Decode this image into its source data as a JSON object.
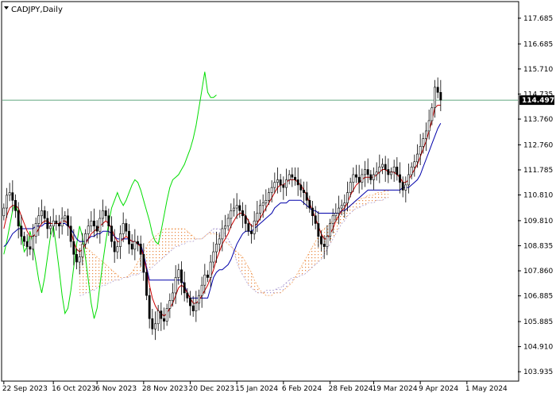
{
  "chart_data": {
    "type": "candlestick",
    "title": "CADJPY,Daily",
    "current_price": "114.497",
    "current_price_value": 114.497,
    "ylim": [
      103.6,
      118.3
    ],
    "y_ticks": [
      {
        "label": "117.685",
        "value": 117.685
      },
      {
        "label": "116.685",
        "value": 116.685
      },
      {
        "label": "115.710",
        "value": 115.71
      },
      {
        "label": "114.735",
        "value": 114.735
      },
      {
        "label": "113.760",
        "value": 113.76
      },
      {
        "label": "112.760",
        "value": 112.76
      },
      {
        "label": "111.785",
        "value": 111.785
      },
      {
        "label": "110.810",
        "value": 110.81
      },
      {
        "label": "109.810",
        "value": 109.81
      },
      {
        "label": "108.835",
        "value": 108.835
      },
      {
        "label": "107.860",
        "value": 107.86
      },
      {
        "label": "106.885",
        "value": 106.885
      },
      {
        "label": "105.885",
        "value": 105.885
      },
      {
        "label": "104.910",
        "value": 104.91
      },
      {
        "label": "103.935",
        "value": 103.935
      }
    ],
    "x_ticks": [
      {
        "label": "22 Sep 2023",
        "index": 0
      },
      {
        "label": "16 Oct 2023",
        "index": 17
      },
      {
        "label": "6 Nov 2023",
        "index": 32
      },
      {
        "label": "28 Nov 2023",
        "index": 48
      },
      {
        "label": "20 Dec 2023",
        "index": 64
      },
      {
        "label": "15 Jan 2024",
        "index": 80
      },
      {
        "label": "6 Feb 2024",
        "index": 96
      },
      {
        "label": "28 Feb 2024",
        "index": 112
      },
      {
        "label": "19 Mar 2024",
        "index": 127
      },
      {
        "label": "9 Apr 2024",
        "index": 143
      },
      {
        "label": "1 May 2024",
        "index": 159
      }
    ],
    "candles_close": [
      110.3,
      110.8,
      110.9,
      110.6,
      110.2,
      109.6,
      109.2,
      109.0,
      108.8,
      108.7,
      109.2,
      109.7,
      110.0,
      110.2,
      109.9,
      109.5,
      109.6,
      109.8,
      109.7,
      109.6,
      109.9,
      110.0,
      109.6,
      109.0,
      108.5,
      108.2,
      108.4,
      108.9,
      109.3,
      109.6,
      109.8,
      109.6,
      109.4,
      109.9,
      110.2,
      110.0,
      109.6,
      109.0,
      108.6,
      108.8,
      109.3,
      109.7,
      109.4,
      108.9,
      108.7,
      109.0,
      108.9,
      108.5,
      107.8,
      106.9,
      106.0,
      105.6,
      105.8,
      106.3,
      106.0,
      105.9,
      106.4,
      106.7,
      107.0,
      107.6,
      107.9,
      107.4,
      107.0,
      106.8,
      106.5,
      106.3,
      106.6,
      106.9,
      107.3,
      107.7,
      107.6,
      108.2,
      108.6,
      108.9,
      109.1,
      109.5,
      109.6,
      109.9,
      110.2,
      110.3,
      110.4,
      110.2,
      110.0,
      109.7,
      109.4,
      109.3,
      109.8,
      110.1,
      110.4,
      110.5,
      110.6,
      110.9,
      111.1,
      111.3,
      111.4,
      111.2,
      111.1,
      111.4,
      111.6,
      111.5,
      111.4,
      111.2,
      111.0,
      110.9,
      110.6,
      110.3,
      110.0,
      109.7,
      109.2,
      108.9,
      108.8,
      109.2,
      109.7,
      110.0,
      110.1,
      110.3,
      110.4,
      110.5,
      110.9,
      111.3,
      111.6,
      111.5,
      111.3,
      111.6,
      111.8,
      111.6,
      111.4,
      111.6,
      111.7,
      111.9,
      112.0,
      111.8,
      111.6,
      111.7,
      111.9,
      111.6,
      111.3,
      111.0,
      111.2,
      111.6,
      111.9,
      112.1,
      112.4,
      112.7,
      113.0,
      113.3,
      113.7,
      114.2,
      115.0,
      114.8,
      114.5
    ],
    "tenkan_sen": [
      109.5,
      110.0,
      110.3,
      110.4,
      110.4,
      110.3,
      110.0,
      109.7,
      109.4,
      109.2,
      109.2,
      109.3,
      109.5,
      109.7,
      109.8,
      109.8,
      109.7,
      109.7,
      109.7,
      109.7,
      109.8,
      109.8,
      109.7,
      109.4,
      109.0,
      108.7,
      108.6,
      108.7,
      108.9,
      109.1,
      109.3,
      109.4,
      109.5,
      109.6,
      109.7,
      109.8,
      109.7,
      109.5,
      109.2,
      109.0,
      109.0,
      109.1,
      109.2,
      109.1,
      109.0,
      109.0,
      108.9,
      108.8,
      108.4,
      107.9,
      107.3,
      106.8,
      106.5,
      106.3,
      106.2,
      106.1,
      106.2,
      106.4,
      106.6,
      106.9,
      107.2,
      107.3,
      107.2,
      107.0,
      106.8,
      106.6,
      106.6,
      106.7,
      106.9,
      107.1,
      107.3,
      107.6,
      107.9,
      108.3,
      108.6,
      108.9,
      109.1,
      109.3,
      109.6,
      109.8,
      110.0,
      110.1,
      110.1,
      110.0,
      109.8,
      109.6,
      109.6,
      109.7,
      109.9,
      110.1,
      110.3,
      110.5,
      110.7,
      110.9,
      111.1,
      111.2,
      111.2,
      111.3,
      111.4,
      111.4,
      111.4,
      111.3,
      111.2,
      111.0,
      110.8,
      110.5,
      110.2,
      109.9,
      109.6,
      109.3,
      109.1,
      109.1,
      109.3,
      109.5,
      109.8,
      110.0,
      110.2,
      110.3,
      110.5,
      110.8,
      111.0,
      111.2,
      111.3,
      111.4,
      111.5,
      111.5,
      111.5,
      111.5,
      111.6,
      111.7,
      111.8,
      111.8,
      111.7,
      111.7,
      111.7,
      111.6,
      111.5,
      111.3,
      111.3,
      111.4,
      111.6,
      111.8,
      112.0,
      112.3,
      112.6,
      112.9,
      113.3,
      113.7,
      114.2,
      114.3,
      114.3
    ],
    "kijun_sen": [
      108.8,
      108.9,
      109.1,
      109.3,
      109.4,
      109.5,
      109.5,
      109.5,
      109.5,
      109.5,
      109.5,
      109.6,
      109.6,
      109.6,
      109.7,
      109.7,
      109.7,
      109.7,
      109.7,
      109.7,
      109.7,
      109.7,
      109.6,
      109.5,
      109.3,
      109.1,
      109.0,
      109.0,
      109.0,
      109.1,
      109.2,
      109.2,
      109.3,
      109.3,
      109.4,
      109.4,
      109.4,
      109.3,
      109.2,
      109.1,
      109.1,
      109.1,
      109.1,
      109.1,
      109.0,
      109.0,
      108.9,
      108.9,
      108.5,
      108.0,
      107.5,
      107.5,
      107.5,
      107.5,
      107.5,
      107.5,
      107.5,
      107.5,
      107.5,
      107.5,
      107.5,
      107.5,
      107.3,
      107.0,
      106.8,
      106.8,
      106.8,
      106.8,
      106.8,
      106.8,
      106.8,
      107.2,
      107.6,
      107.8,
      107.9,
      107.9,
      108.0,
      108.1,
      108.3,
      108.6,
      108.9,
      109.1,
      109.3,
      109.4,
      109.4,
      109.4,
      109.5,
      109.6,
      109.7,
      109.8,
      109.9,
      110.0,
      110.1,
      110.3,
      110.4,
      110.5,
      110.5,
      110.5,
      110.6,
      110.6,
      110.6,
      110.6,
      110.6,
      110.5,
      110.4,
      110.3,
      110.2,
      110.2,
      110.1,
      110.1,
      110.1,
      110.1,
      110.1,
      110.1,
      110.1,
      110.1,
      110.2,
      110.2,
      110.3,
      110.4,
      110.5,
      110.6,
      110.7,
      110.8,
      110.9,
      111.0,
      111.0,
      111.0,
      111.0,
      111.0,
      111.0,
      111.0,
      111.0,
      111.0,
      111.0,
      111.0,
      111.0,
      111.1,
      111.1,
      111.1,
      111.2,
      111.3,
      111.4,
      111.6,
      111.9,
      112.2,
      112.5,
      112.8,
      113.1,
      113.4,
      113.6
    ],
    "chikou_span": [
      108.5,
      109.0,
      109.6,
      110.2,
      110.5,
      110.0,
      109.3,
      108.6,
      108.8,
      109.4,
      108.9,
      108.2,
      107.5,
      107.0,
      107.6,
      108.4,
      109.2,
      109.6,
      108.8,
      107.9,
      106.9,
      106.2,
      106.4,
      107.1,
      108.0,
      108.9,
      109.6,
      109.2,
      108.4,
      107.5,
      106.6,
      106.0,
      106.4,
      107.3,
      108.2,
      109.0,
      109.7,
      110.3,
      110.6,
      110.9,
      110.6,
      110.4,
      110.6,
      110.9,
      111.2,
      111.4,
      111.3,
      111.0,
      110.6,
      110.2,
      109.8,
      109.3,
      109.0,
      108.9,
      109.4,
      110.0,
      110.6,
      111.1,
      111.4,
      111.5,
      111.6,
      111.8,
      112.0,
      112.3,
      112.6,
      113.0,
      113.5,
      114.2,
      114.9,
      115.6,
      114.8,
      114.6,
      114.6,
      114.7
    ],
    "senkou_a": [
      109.0,
      108.9,
      108.8,
      108.7,
      108.6,
      108.5,
      108.4,
      108.3,
      108.2,
      108.1,
      108.0,
      107.9,
      107.8,
      107.7,
      107.6,
      107.6,
      107.6,
      107.7,
      107.8,
      108.0,
      108.2,
      108.4,
      108.6,
      108.8,
      109.0,
      109.1,
      109.2,
      109.3,
      109.4,
      109.5,
      109.5,
      109.5,
      109.5,
      109.5,
      109.5,
      109.5,
      109.5,
      109.4,
      109.3,
      109.2,
      109.1,
      109.1,
      109.1,
      109.2,
      109.3,
      109.3,
      109.3,
      109.3,
      109.2,
      109.1,
      109.0,
      108.9,
      108.8,
      108.7,
      108.6,
      108.5,
      108.4,
      108.2,
      108.0,
      107.8,
      107.5,
      107.3,
      107.1,
      107.0,
      106.9,
      106.9,
      106.9,
      107.0,
      107.0,
      107.0,
      107.1,
      107.2,
      107.3,
      107.4,
      107.6,
      107.8,
      108.0,
      108.2,
      108.4,
      108.6,
      108.8,
      109.0,
      109.2,
      109.4,
      109.5,
      109.6,
      109.7,
      109.8,
      109.9,
      110.0,
      110.1,
      110.2,
      110.3,
      110.4,
      110.5,
      110.6,
      110.6,
      110.7,
      110.7,
      110.8,
      110.8,
      110.8,
      110.9,
      110.9,
      110.9,
      111.0,
      111.0
    ],
    "senkou_b": [
      106.9,
      106.9,
      107.0,
      107.0,
      107.1,
      107.1,
      107.2,
      107.2,
      107.3,
      107.3,
      107.4,
      107.4,
      107.5,
      107.5,
      107.5,
      107.6,
      107.6,
      107.6,
      107.7,
      107.7,
      107.7,
      107.8,
      107.8,
      107.8,
      107.9,
      108.0,
      108.1,
      108.2,
      108.3,
      108.4,
      108.5,
      108.6,
      108.7,
      108.8,
      108.8,
      108.9,
      108.9,
      109.0,
      109.0,
      109.0,
      109.1,
      109.1,
      109.1,
      109.2,
      109.3,
      109.4,
      109.5,
      109.5,
      109.5,
      109.4,
      109.3,
      109.1,
      108.9,
      108.6,
      108.2,
      107.9,
      107.7,
      107.5,
      107.3,
      107.2,
      107.1,
      107.0,
      107.0,
      107.0,
      107.1,
      107.1,
      107.1,
      107.1,
      107.2,
      107.2,
      107.3,
      107.4,
      107.5,
      107.6,
      107.6,
      107.6,
      107.7,
      107.7,
      107.8,
      107.9,
      108.0,
      108.1,
      108.2,
      108.3,
      108.5,
      108.7,
      108.9,
      109.1,
      109.3,
      109.5,
      109.7,
      109.8,
      110.0,
      110.1,
      110.2,
      110.3,
      110.3,
      110.4,
      110.4,
      110.5,
      110.5,
      110.5,
      110.6,
      110.6,
      110.6,
      110.7,
      110.7
    ],
    "colors": {
      "bull": "#ffffff",
      "bear": "#000000",
      "tenkan": "#cc0000",
      "kijun": "#0000aa",
      "chikou": "#00dd00",
      "cloud_bull": "#f4a460",
      "cloud_bear": "#b0a0d0",
      "price_line": "#2e8b57",
      "price_label_bg": "#000000"
    }
  }
}
